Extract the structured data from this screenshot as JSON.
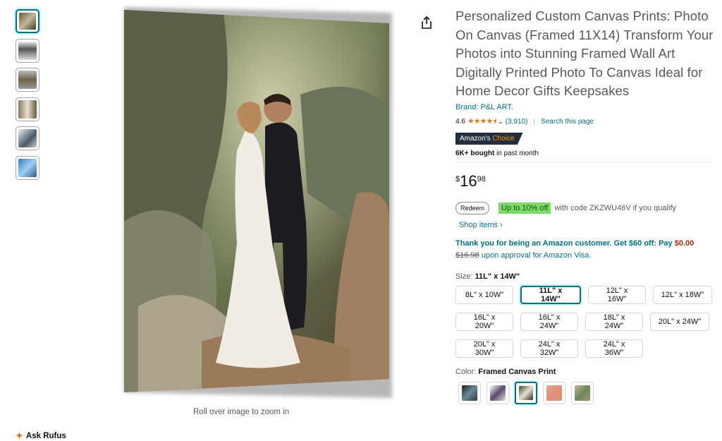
{
  "product": {
    "title": "Personalized Custom Canvas Prints: Photo On Canvas (Framed 11X14) Transform Your Photos into Stunning Framed Wall Art Digitally Printed Photo To Canvas Ideal for Home Decor Gifts Keepsakes",
    "brand": "Brand: P&L ART.",
    "rating": "4.6",
    "stars": "★★★★⯨",
    "rating_count": "(3,910)",
    "search_page": "Search this page",
    "badge_prefix": "Amazon's",
    "badge_choice": "Choice",
    "bought_bold": "6K+ bought",
    "bought_rest": "in past month",
    "price_currency": "$",
    "price_whole": "16",
    "price_fraction": "98"
  },
  "coupon": {
    "redeem": "Redeem",
    "offer": "Up to 10% off",
    "code_text": "with code ZKZWU46V if you qualify",
    "shop_items": "Shop items ›"
  },
  "visa": {
    "line1": "Thank you for being an Amazon customer. Get $60 off: Pay",
    "pay": "$0.00",
    "strike": "$16.98",
    "line2": "upon approval for Amazon Visa."
  },
  "size": {
    "label": "Size:",
    "selected": "11L\" x 14W\"",
    "options": [
      "8L\" x 10W\"",
      "11L\" x 14W\"",
      "12L\" x 16W\"",
      "12L\" x 18W\"",
      "16L\" x 20W\"",
      "16L\" x 24W\"",
      "18L\" x 24W\"",
      "20L\" x 24W\"",
      "20L\" x 30W\"",
      "24L\" x 32W\"",
      "24L\" x 36W\""
    ]
  },
  "color": {
    "label": "Color:",
    "selected": "Framed Canvas Print"
  },
  "image": {
    "zoom_hint": "Roll over image to zoom in"
  },
  "rufus": {
    "label": "Ask Rufus"
  },
  "colors": {
    "link": "#007185",
    "star": "#de7921",
    "price_red": "#b12704",
    "offer_green": "#7fda69"
  }
}
